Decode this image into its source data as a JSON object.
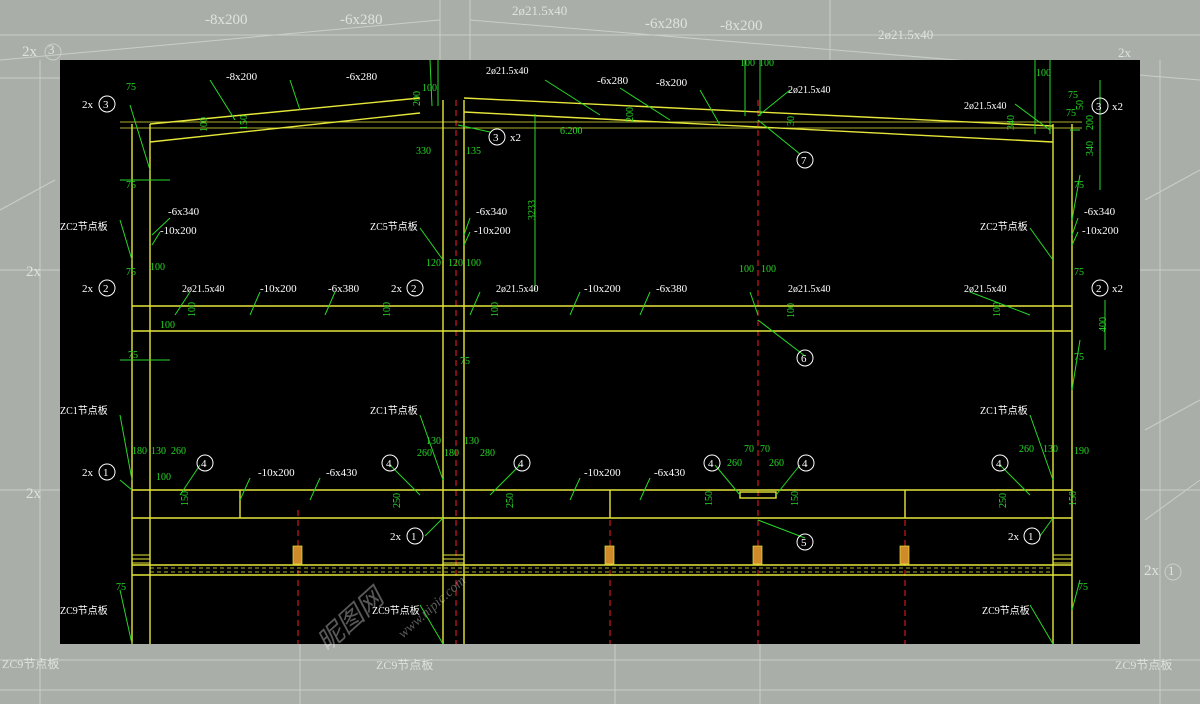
{
  "background": {
    "labels": [
      "-8x200",
      "-6x280",
      "2ø21.5x40",
      "-6x280",
      "-8x200",
      "2ø21.5x40",
      "2x",
      "2x",
      "2x",
      "2x",
      "ZC9节点板",
      "ZC9节点板",
      "ZC9节点板",
      "2x"
    ],
    "circle_numbers": [
      "3",
      "1"
    ]
  },
  "drawing": {
    "bolt": "ø21.5x40",
    "roof": {
      "plates": [
        "-8x200",
        "-6x280",
        "2ø21.5x40",
        "-6x280",
        "-8x200",
        "2ø21.5x40",
        "2ø21.5x40"
      ],
      "dims": [
        "75",
        "75",
        "100",
        "100",
        "100",
        "100",
        "75",
        "340",
        "200",
        "50",
        "340",
        "200",
        "330",
        "135",
        "3233",
        "6.200",
        "100",
        "150",
        "200",
        "30"
      ],
      "callouts": [
        "2x",
        "3",
        "3",
        "x2",
        "3",
        "x2",
        "7"
      ]
    },
    "upper": {
      "plates": [
        "-6x340",
        "-10x200",
        "-6x340",
        "-10x200",
        "-6x340",
        "-10x200",
        "ZC5节点板",
        "ZC2节点板",
        "ZC2节点板"
      ],
      "dims": [
        "75",
        "75",
        "75",
        "75",
        "120",
        "120",
        "100",
        "100",
        "100",
        "100",
        "100",
        "100",
        "400",
        "100",
        "100",
        "100",
        "100"
      ],
      "mid_plates": [
        "2ø21.5x40",
        "-10x200",
        "-6x380",
        "2ø21.5x40",
        "-10x200",
        "-6x380",
        "2ø21.5x40",
        "2ø21.5x40"
      ],
      "callouts": [
        "2x",
        "2",
        "2x",
        "2",
        "2",
        "x2",
        "6"
      ]
    },
    "lower": {
      "plates": [
        "ZC1节点板",
        "ZC1节点板",
        "ZC1节点板",
        "-10x200",
        "-6x430",
        "-10x200",
        "-6x430"
      ],
      "dims": [
        "75",
        "75",
        "75",
        "180",
        "130",
        "260",
        "130",
        "130",
        "260",
        "180",
        "280",
        "70",
        "70",
        "260",
        "260",
        "260",
        "130",
        "190",
        "250",
        "250",
        "150",
        "150",
        "150",
        "250",
        "150",
        "100"
      ],
      "callouts": [
        "2x",
        "1",
        "4",
        "4",
        "4",
        "4",
        "4",
        "4",
        "5",
        "2x",
        "1",
        "2x",
        "1"
      ]
    },
    "bottom": {
      "plates": [
        "ZC9节点板",
        "ZC9节点板",
        "ZC9节点板"
      ],
      "dims": [
        "75",
        "75"
      ]
    }
  },
  "watermark": {
    "logo_text": "昵图网",
    "url_text": "www.nipic.com"
  },
  "colors": {
    "background_gray": "#a9aea9",
    "canvas": "#000000",
    "structure_yellow": "#e6e63a",
    "dimension_green": "#27d827",
    "text_white": "#ffffff",
    "centerline_red": "#c0141a",
    "plate_orange": "#d08a2a"
  }
}
